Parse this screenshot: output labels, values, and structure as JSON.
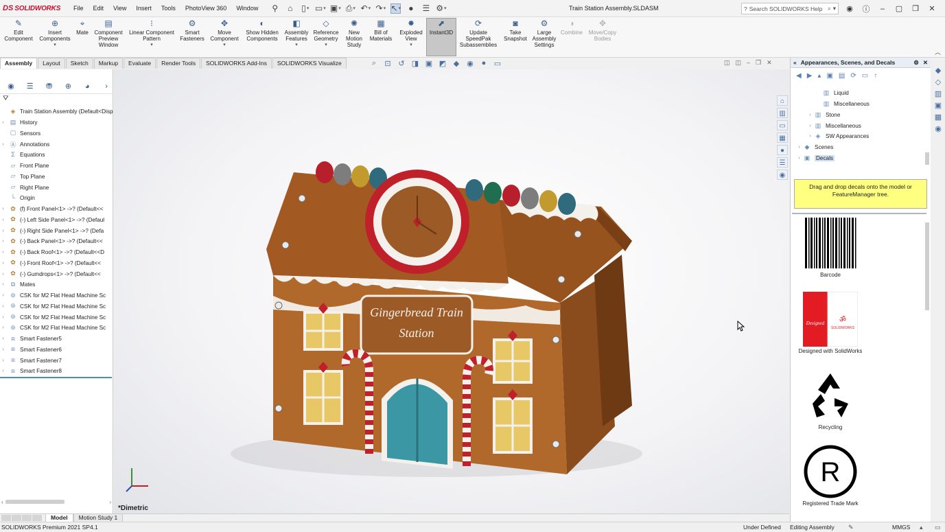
{
  "app": {
    "logo_mark": "DS",
    "logo_text": "SOLIDWORKS"
  },
  "menu": [
    "File",
    "Edit",
    "View",
    "Insert",
    "Tools",
    "PhotoView 360",
    "Window"
  ],
  "document_title": "Train Station Assembly.SLDASM",
  "search": {
    "placeholder": "Search SOLIDWORKS Help"
  },
  "commands": [
    {
      "label": "Edit Component",
      "icon": "edit-component-icon",
      "state": "disabled"
    },
    {
      "label": "Insert Components",
      "icon": "insert-components-icon",
      "state": "normal",
      "dropdown": true
    },
    {
      "label": "Mate",
      "icon": "mate-icon",
      "state": "normal"
    },
    {
      "label": "Component Preview Window",
      "icon": "component-preview-icon",
      "state": "disabled"
    },
    {
      "label": "Linear Component Pattern",
      "icon": "linear-pattern-icon",
      "state": "normal",
      "dropdown": true
    },
    {
      "label": "Smart Fasteners",
      "icon": "smart-fasteners-icon",
      "state": "normal"
    },
    {
      "label": "Move Component",
      "icon": "move-component-icon",
      "state": "normal",
      "dropdown": true
    },
    {
      "label": "Show Hidden Components",
      "icon": "show-hidden-icon",
      "state": "normal"
    },
    {
      "label": "Assembly Features",
      "icon": "assembly-features-icon",
      "state": "normal",
      "dropdown": true
    },
    {
      "label": "Reference Geometry",
      "icon": "reference-geometry-icon",
      "state": "normal",
      "dropdown": true
    },
    {
      "label": "New Motion Study",
      "icon": "motion-study-icon",
      "state": "normal"
    },
    {
      "label": "Bill of Materials",
      "icon": "bill-of-materials-icon",
      "state": "normal"
    },
    {
      "label": "Exploded View",
      "icon": "exploded-view-icon",
      "state": "normal",
      "dropdown": true
    },
    {
      "label": "Instant3D",
      "icon": "instant3d-icon",
      "state": "active"
    },
    {
      "label": "Update SpeedPak Subassemblies",
      "icon": "speedpak-icon",
      "state": "normal"
    },
    {
      "label": "Take Snapshot",
      "icon": "snapshot-icon",
      "state": "normal"
    },
    {
      "label": "Large Assembly Settings",
      "icon": "large-assembly-icon",
      "state": "normal"
    },
    {
      "label": "Combine",
      "icon": "combine-icon",
      "state": "disabled"
    },
    {
      "label": "Move/Copy Bodies",
      "icon": "move-copy-bodies-icon",
      "state": "disabled"
    }
  ],
  "tabs": [
    "Assembly",
    "Layout",
    "Sketch",
    "Markup",
    "Evaluate",
    "Render Tools",
    "SOLIDWORKS Add-Ins",
    "SOLIDWORKS Visualize"
  ],
  "active_tab": "Assembly",
  "feature_tree": [
    {
      "label": "Train Station Assembly  (Default<Disp",
      "icon": "assembly-icon",
      "expand": false
    },
    {
      "label": "History",
      "icon": "history-icon",
      "expand": true
    },
    {
      "label": "Sensors",
      "icon": "sensors-icon",
      "expand": false
    },
    {
      "label": "Annotations",
      "icon": "annotations-icon",
      "expand": true
    },
    {
      "label": "Equations",
      "icon": "equations-icon",
      "expand": false
    },
    {
      "label": "Front Plane",
      "icon": "plane-icon",
      "expand": false
    },
    {
      "label": "Top Plane",
      "icon": "plane-icon",
      "expand": false
    },
    {
      "label": "Right Plane",
      "icon": "plane-icon",
      "expand": false
    },
    {
      "label": "Origin",
      "icon": "origin-icon",
      "expand": false
    },
    {
      "label": "(f) Front Panel<1> ->? (Default<<",
      "icon": "part-icon",
      "expand": true
    },
    {
      "label": "(-) Left Side Panel<1> ->? (Defaul",
      "icon": "part-icon",
      "expand": true
    },
    {
      "label": "(-) Right Side Panel<1> ->? (Defa",
      "icon": "part-icon",
      "expand": true
    },
    {
      "label": "(-) Back Panel<1> ->? (Default<<",
      "icon": "part-icon",
      "expand": true
    },
    {
      "label": "(-) Back Roof<1> ->? (Default<<D",
      "icon": "part-icon",
      "expand": true
    },
    {
      "label": "(-) Front Roof<1> ->? (Default<<",
      "icon": "part-icon",
      "expand": true
    },
    {
      "label": "(-) Gumdrops<1> ->? (Default<<",
      "icon": "part-icon",
      "expand": true
    },
    {
      "label": "Mates",
      "icon": "mates-icon",
      "expand": true
    },
    {
      "label": "CSK for M2 Flat Head Machine Sc",
      "icon": "feature-icon",
      "expand": true
    },
    {
      "label": "CSK for M2 Flat Head Machine Sc",
      "icon": "feature-icon",
      "expand": true
    },
    {
      "label": "CSK for M2 Flat Head Machine Sc",
      "icon": "feature-icon",
      "expand": true
    },
    {
      "label": "CSK for M2 Flat Head Machine Sc",
      "icon": "feature-icon",
      "expand": true
    },
    {
      "label": "Smart Fastener5",
      "icon": "fastener-icon",
      "expand": true
    },
    {
      "label": "Smart Fastener6",
      "icon": "fastener-icon",
      "expand": true
    },
    {
      "label": "Smart Fastener7",
      "icon": "fastener-icon",
      "expand": true
    },
    {
      "label": "Smart Fastener8",
      "icon": "fastener-icon",
      "expand": true
    }
  ],
  "viewport": {
    "view_label": "*Dimetric"
  },
  "model": {
    "sign_line1": "Gingerbread Train",
    "sign_line2": "Station",
    "colors": {
      "wall": "#b0692a",
      "roof": "#a35a22",
      "frosting": "#f4f1ec",
      "door": "#3c97a4",
      "candy_red": "#c0202a",
      "window": "#e7c766"
    }
  },
  "task_pane": {
    "title": "Appearances, Scenes, and Decals",
    "tree": [
      {
        "label": "Liquid",
        "indent": 3,
        "expand": false,
        "icon": "folder-icon"
      },
      {
        "label": "Miscellaneous",
        "indent": 3,
        "expand": false,
        "icon": "folder-icon"
      },
      {
        "label": "Stone",
        "indent": 2,
        "expand": true,
        "icon": "folder-icon"
      },
      {
        "label": "Miscellaneous",
        "indent": 2,
        "expand": true,
        "icon": "folder-icon"
      },
      {
        "label": "SW Appearances",
        "indent": 2,
        "expand": true,
        "icon": "folder-icon"
      },
      {
        "label": "Scenes",
        "indent": 1,
        "expand": true,
        "icon": "scenes-icon"
      },
      {
        "label": "Decals",
        "indent": 1,
        "expand": true,
        "icon": "decals-icon",
        "selected": true
      }
    ],
    "hint": "Drag and drop decals onto the model or FeatureManager tree.",
    "decals": [
      {
        "label": "Barcode",
        "icon": "barcode-icon"
      },
      {
        "label": "Designed with SolidWorks",
        "icon": "solidworks-decal-icon"
      },
      {
        "label": "Recycling",
        "icon": "recycling-icon"
      },
      {
        "label": "Registered Trade Mark",
        "icon": "registered-icon"
      }
    ]
  },
  "bottom_tabs": [
    "Model",
    "Motion Study 1"
  ],
  "status": {
    "version": "SOLIDWORKS Premium 2021 SP4.1",
    "constraint": "Under Defined",
    "mode": "Editing Assembly",
    "units": "MMGS"
  }
}
